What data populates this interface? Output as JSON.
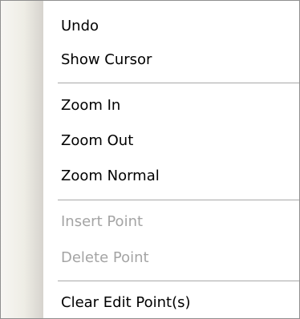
{
  "context_menu": {
    "items": [
      {
        "label": "Undo",
        "enabled": true
      },
      {
        "label": "Show Cursor",
        "enabled": true
      },
      {
        "label": "Zoom In",
        "enabled": true
      },
      {
        "label": "Zoom Out",
        "enabled": true
      },
      {
        "label": "Zoom Normal",
        "enabled": true
      },
      {
        "label": "Insert Point",
        "enabled": false
      },
      {
        "label": "Delete Point",
        "enabled": false
      },
      {
        "label": "Clear Edit Point(s)",
        "enabled": true
      }
    ],
    "colors": {
      "text": "#000000",
      "disabled_text": "#a4a4a4",
      "separator": "#a8a8a8",
      "border": "#8f8f8f"
    }
  }
}
